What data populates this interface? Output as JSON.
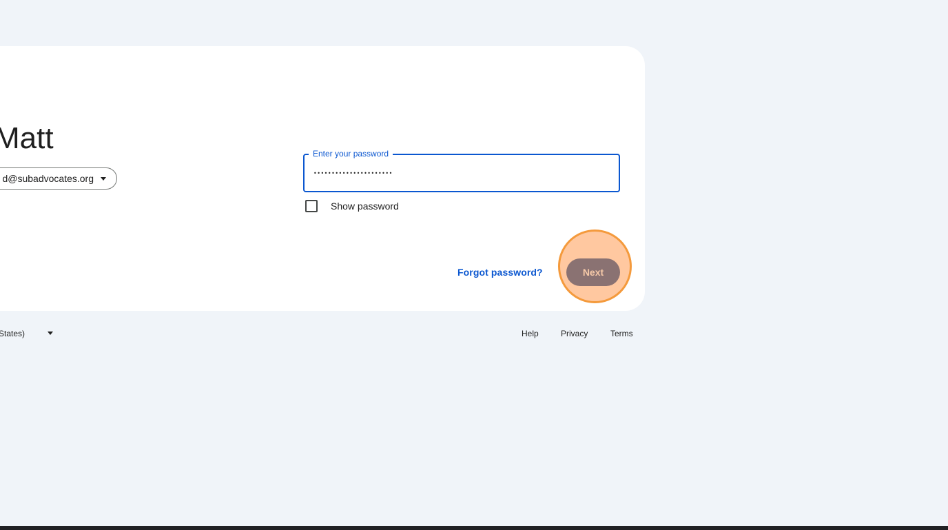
{
  "greeting": "Matt",
  "account_chip": {
    "email": "d@subadvocates.org",
    "icon": "chevron-down-icon"
  },
  "password": {
    "label": "Enter your password",
    "value": "••••••••••••••••••••••",
    "show_password_label": "Show password",
    "show_password_checked": false
  },
  "actions": {
    "forgot_label": "Forgot password?",
    "next_label": "Next"
  },
  "footer": {
    "language": "States)",
    "language_icon": "chevron-down-icon",
    "help": "Help",
    "privacy": "Privacy",
    "terms": "Terms"
  },
  "colors": {
    "background": "#f0f4f9",
    "accent": "#0b57d0",
    "highlight": "#f49a3c"
  }
}
